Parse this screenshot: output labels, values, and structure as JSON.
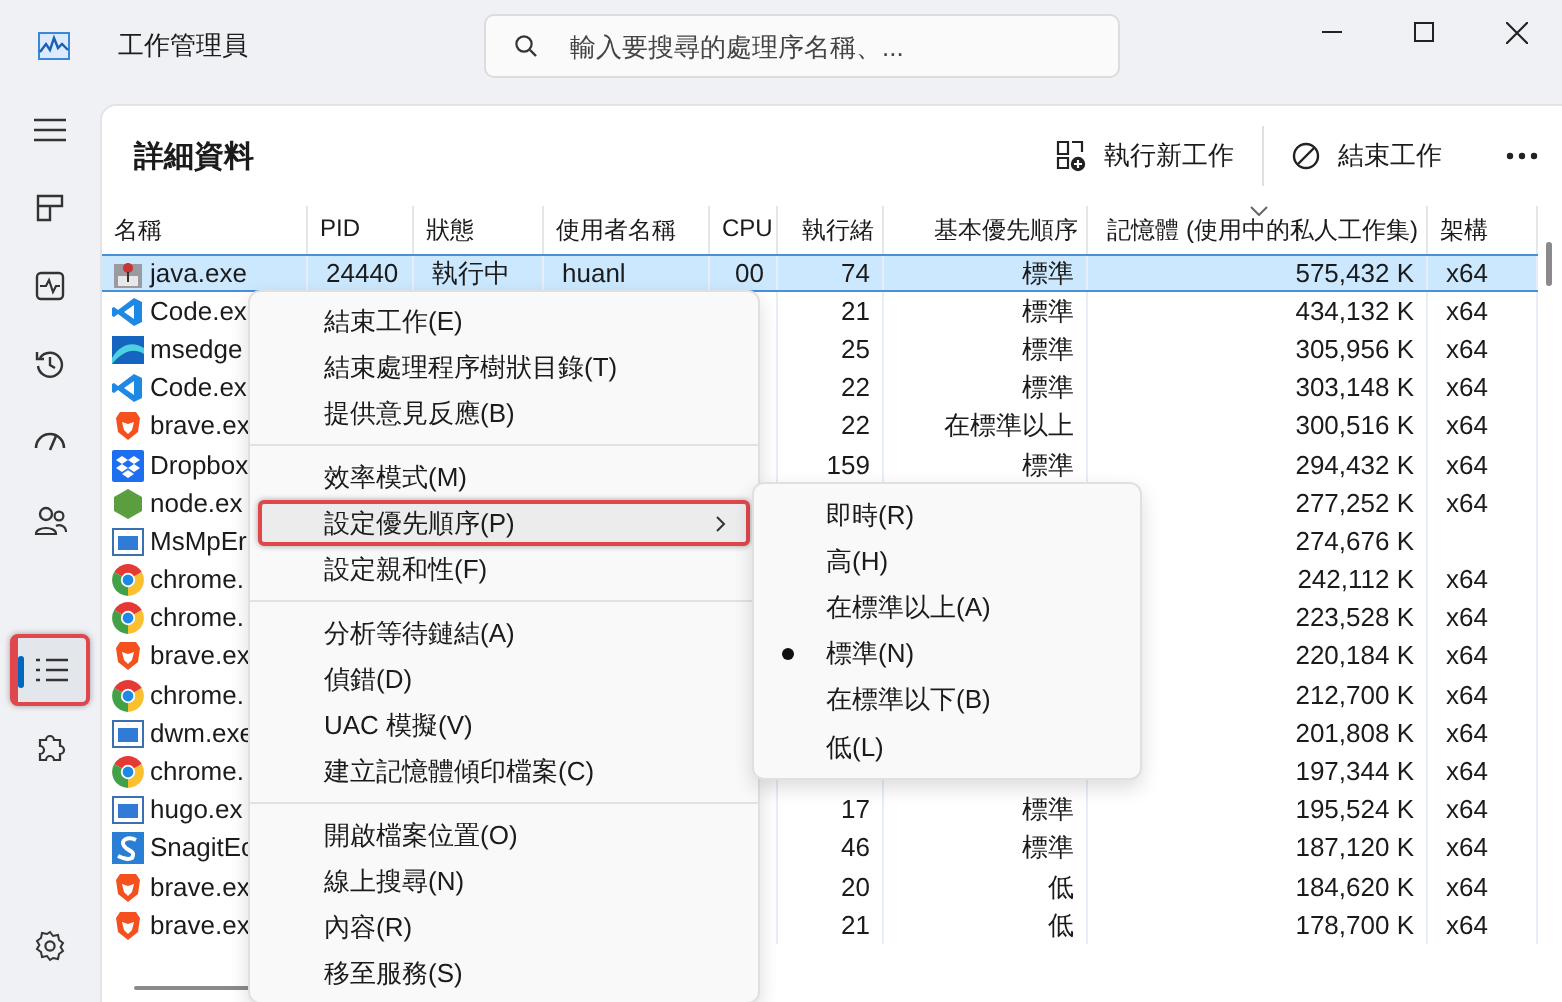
{
  "window": {
    "title": "工作管理員"
  },
  "search": {
    "placeholder": "輸入要搜尋的處理序名稱、..."
  },
  "nav": [
    {
      "kind": "processes",
      "selected": false,
      "highlighted": false
    },
    {
      "kind": "performance",
      "selected": false,
      "highlighted": false
    },
    {
      "kind": "history",
      "selected": false,
      "highlighted": false
    },
    {
      "kind": "startup",
      "selected": false,
      "highlighted": false
    },
    {
      "kind": "users",
      "selected": false,
      "highlighted": false
    },
    {
      "kind": "details",
      "selected": true,
      "highlighted": true
    },
    {
      "kind": "services",
      "selected": false,
      "highlighted": false
    }
  ],
  "page": {
    "title": "詳細資料",
    "actions": [
      {
        "kind": "run",
        "label": "執行新工作"
      },
      {
        "kind": "end",
        "label": "結束工作"
      }
    ]
  },
  "table": {
    "columns": [
      {
        "label": "名稱",
        "sorted": false
      },
      {
        "label": "PID",
        "sorted": false
      },
      {
        "label": "狀態",
        "sorted": false
      },
      {
        "label": "使用者名稱",
        "sorted": false
      },
      {
        "label": "CPU",
        "sorted": false
      },
      {
        "label": "執行緒",
        "sorted": false
      },
      {
        "label": "基本優先順序",
        "sorted": false
      },
      {
        "label": "記憶體 (使用中的私人工作集)",
        "sorted": true
      },
      {
        "label": "架構",
        "sorted": false
      }
    ],
    "rows": [
      {
        "kind": "java",
        "selected": true,
        "name": "java.exe",
        "pid": "24440",
        "status": "執行中",
        "user": "huanl",
        "cpu": "00",
        "threads": "74",
        "priority": "標準",
        "memory": "575,432 K",
        "arch": "x64"
      },
      {
        "kind": "code",
        "selected": false,
        "name": "Code.ex",
        "threads": "21",
        "priority": "標準",
        "memory": "434,132 K",
        "arch": "x64"
      },
      {
        "kind": "edge",
        "selected": false,
        "name": "msedge",
        "threads": "25",
        "priority": "標準",
        "memory": "305,956 K",
        "arch": "x64"
      },
      {
        "kind": "code",
        "selected": false,
        "name": "Code.ex",
        "threads": "22",
        "priority": "標準",
        "memory": "303,148 K",
        "arch": "x64"
      },
      {
        "kind": "brave",
        "selected": false,
        "name": "brave.ex",
        "threads": "22",
        "priority": "在標準以上",
        "memory": "300,516 K",
        "arch": "x64"
      },
      {
        "kind": "dropbox",
        "selected": false,
        "name": "Dropbox",
        "threads": "159",
        "priority": "標準",
        "memory": "294,432 K",
        "arch": "x64"
      },
      {
        "kind": "node",
        "selected": false,
        "name": "node.ex",
        "memory": "277,252 K",
        "arch": "x64"
      },
      {
        "kind": "window",
        "selected": false,
        "name": "MsMpEr",
        "memory": "274,676 K"
      },
      {
        "kind": "chrome",
        "selected": false,
        "name": "chrome.",
        "memory": "242,112 K",
        "arch": "x64"
      },
      {
        "kind": "chrome",
        "selected": false,
        "name": "chrome.",
        "memory": "223,528 K",
        "arch": "x64"
      },
      {
        "kind": "brave",
        "selected": false,
        "name": "brave.ex",
        "memory": "220,184 K",
        "arch": "x64"
      },
      {
        "kind": "chrome",
        "selected": false,
        "name": "chrome.",
        "memory": "212,700 K",
        "arch": "x64"
      },
      {
        "kind": "window",
        "selected": false,
        "name": "dwm.exe",
        "memory": "201,808 K",
        "arch": "x64"
      },
      {
        "kind": "chrome",
        "selected": false,
        "name": "chrome.",
        "memory": "197,344 K",
        "arch": "x64"
      },
      {
        "kind": "window",
        "selected": false,
        "name": "hugo.ex",
        "threads": "17",
        "priority": "標準",
        "memory": "195,524 K",
        "arch": "x64"
      },
      {
        "kind": "snagit-editor",
        "selected": false,
        "name": "SnagitEc",
        "threads": "46",
        "priority": "標準",
        "memory": "187,120 K",
        "arch": "x64"
      },
      {
        "kind": "brave",
        "selected": false,
        "name": "brave.ex",
        "threads": "20",
        "priority": "低",
        "memory": "184,620 K",
        "arch": "x64"
      },
      {
        "kind": "brave",
        "selected": false,
        "name": "brave.ex",
        "threads": "21",
        "priority": "低",
        "memory": "178,700 K",
        "arch": "x64"
      }
    ]
  },
  "context_menu": {
    "items": [
      {
        "kind": "item",
        "label": "結束工作(E)",
        "highlighted": false,
        "submenu": false
      },
      {
        "kind": "item",
        "label": "結束處理程序樹狀目錄(T)",
        "highlighted": false,
        "submenu": false
      },
      {
        "kind": "item",
        "label": "提供意見反應(B)",
        "highlighted": false,
        "submenu": false
      },
      {
        "kind": "separator"
      },
      {
        "kind": "item",
        "label": "效率模式(M)",
        "highlighted": false,
        "submenu": false
      },
      {
        "kind": "item",
        "label": "設定優先順序(P)",
        "highlighted": true,
        "submenu": true
      },
      {
        "kind": "item",
        "label": "設定親和性(F)",
        "highlighted": false,
        "submenu": false
      },
      {
        "kind": "separator"
      },
      {
        "kind": "item",
        "label": "分析等待鏈結(A)",
        "highlighted": false,
        "submenu": false
      },
      {
        "kind": "item",
        "label": "偵錯(D)",
        "highlighted": false,
        "submenu": false
      },
      {
        "kind": "item",
        "label": "UAC 模擬(V)",
        "highlighted": false,
        "submenu": false
      },
      {
        "kind": "item",
        "label": "建立記憶體傾印檔案(C)",
        "highlighted": false,
        "submenu": false
      },
      {
        "kind": "separator"
      },
      {
        "kind": "item",
        "label": "開啟檔案位置(O)",
        "highlighted": false,
        "submenu": false
      },
      {
        "kind": "item",
        "label": "線上搜尋(N)",
        "highlighted": false,
        "submenu": false
      },
      {
        "kind": "item",
        "label": "內容(R)",
        "highlighted": false,
        "submenu": false
      },
      {
        "kind": "item",
        "label": "移至服務(S)",
        "highlighted": false,
        "submenu": false
      }
    ]
  },
  "submenu": {
    "items": [
      {
        "label": "即時(R)",
        "selected": false
      },
      {
        "label": "高(H)",
        "selected": false
      },
      {
        "label": "在標準以上(A)",
        "selected": false
      },
      {
        "label": "標準(N)",
        "selected": true
      },
      {
        "label": "在標準以下(B)",
        "selected": false
      },
      {
        "label": "低(L)",
        "selected": false
      }
    ]
  }
}
